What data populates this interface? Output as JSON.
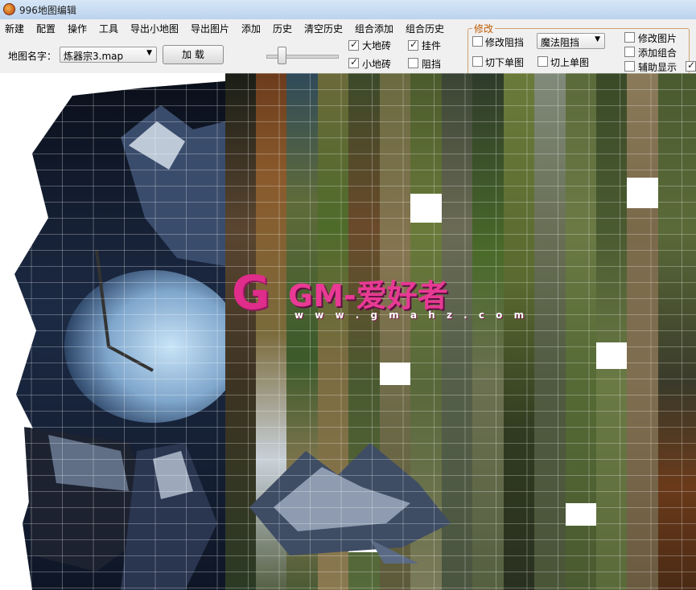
{
  "window": {
    "title": "996地图编辑"
  },
  "menu": [
    "新建",
    "配置",
    "操作",
    "工具",
    "导出小地图",
    "导出图片",
    "添加",
    "历史",
    "清空历史",
    "组合添加",
    "组合历史"
  ],
  "toolbar": {
    "map_name_label": "地图名字：",
    "map_name_value": "炼器宗3.map",
    "load_button": "加 载"
  },
  "layer_options": [
    {
      "label": "大地砖",
      "checked": true
    },
    {
      "label": "挂件",
      "checked": true
    },
    {
      "label": "小地砖",
      "checked": true
    },
    {
      "label": "阻挡",
      "checked": false
    }
  ],
  "modify_group": {
    "title": "修改",
    "modify_block": {
      "label": "修改阻挡",
      "checked": false
    },
    "block_type": "魔法阻挡",
    "cut_down": {
      "label": "切下单图",
      "checked": false
    },
    "cut_up": {
      "label": "切上单图",
      "checked": false
    }
  },
  "right_options": [
    {
      "label": "修改图片",
      "checked": false
    },
    {
      "label": "添加组合",
      "checked": false
    },
    {
      "label": "辅助显示",
      "checked": false
    }
  ],
  "extra_checkbox": {
    "checked": true
  },
  "watermark": {
    "logo": "G",
    "text": "GM-爱好者",
    "url": "w w w . g m a h z . c o m"
  },
  "colors": {
    "accent": "#c05a00",
    "watermark_pink": "#e83a94"
  },
  "icons": {
    "app": "map-editor-app-icon",
    "dropdown": "chevron-down-icon",
    "check": "checkmark-icon"
  }
}
